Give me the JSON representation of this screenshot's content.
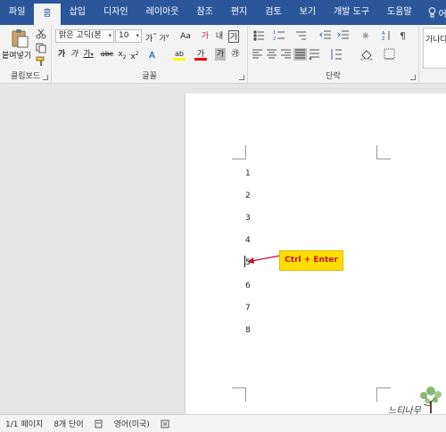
{
  "tabs": [
    "파일",
    "홈",
    "삽입",
    "디자인",
    "레이아웃",
    "참조",
    "편지",
    "검토",
    "보기",
    "개발 도구",
    "도움말"
  ],
  "active_tab": "홈",
  "tell_me": "어떤 작",
  "ribbon": {
    "clipboard": {
      "paste": "붙여넣기",
      "label": "클립보드"
    },
    "font": {
      "font_name": "맑은 고딕(본",
      "font_size": "10",
      "grow": "가",
      "shrink": "가",
      "case": "Aa",
      "clear": "가",
      "phonetic": "내",
      "border_char": "가",
      "bold": "가",
      "italic": "가",
      "underline": "가",
      "strike": "abc",
      "subscript": "x",
      "superscript": "x",
      "font_color": "가",
      "shade": "가",
      "enclose": "㉮",
      "label": "글꼴"
    },
    "paragraph": {
      "label": "단락"
    },
    "styles": {
      "sample": "가나다"
    }
  },
  "document": {
    "lines": [
      "1",
      "2",
      "3",
      "4",
      "5",
      "6",
      "7",
      "8"
    ],
    "annotation": "Ctrl + Enter"
  },
  "statusbar": {
    "page": "1/1 페이지",
    "words": "8개 단어",
    "language": "영어(미국)"
  },
  "watermark": "느티나무",
  "colors": {
    "accent": "#2b579a",
    "callout": "#ffde00",
    "callout_text": "#c8102e"
  }
}
